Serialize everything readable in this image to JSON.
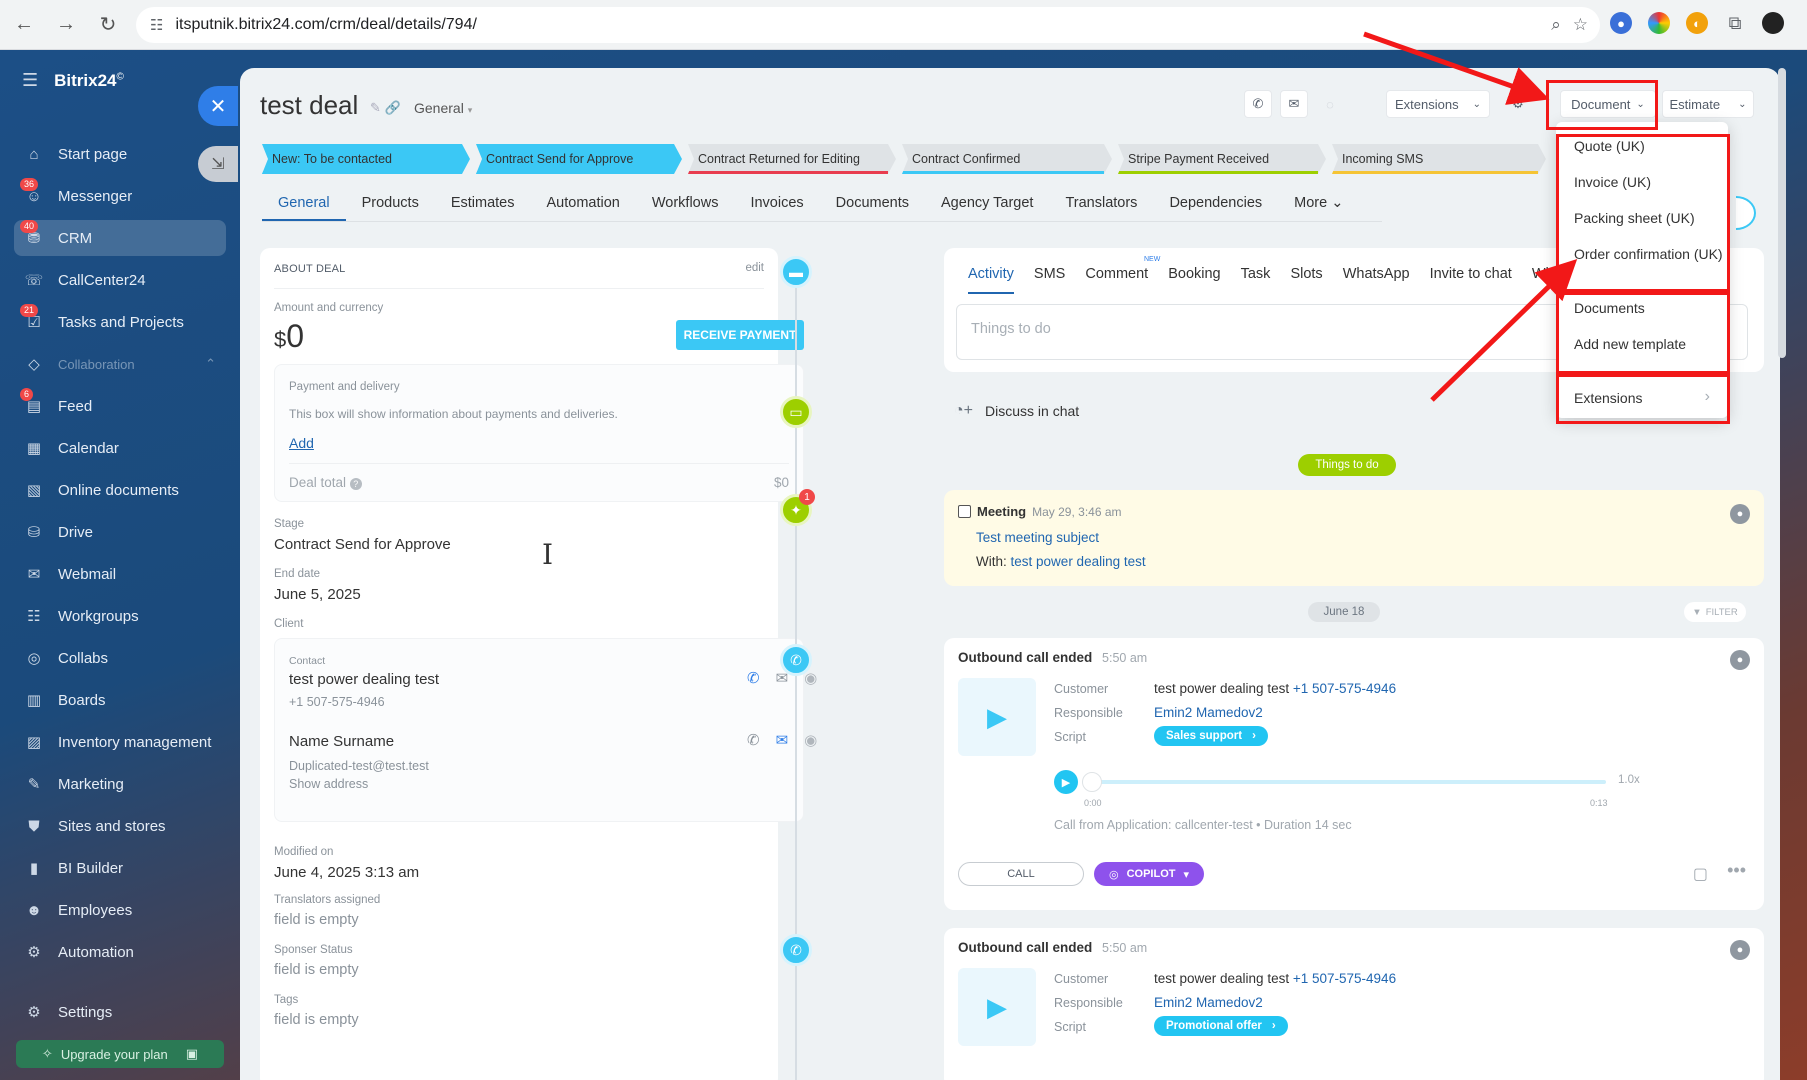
{
  "browser": {
    "url": "itsputnik.bitrix24.com/crm/deal/details/794/"
  },
  "sidebar": {
    "logo": "Bitrix24",
    "logo_sup": "©",
    "items": [
      {
        "label": "Start page",
        "badge": ""
      },
      {
        "label": "Messenger",
        "badge": "36"
      },
      {
        "label": "CRM",
        "badge": "40"
      },
      {
        "label": "CallCenter24",
        "badge": ""
      },
      {
        "label": "Tasks and Projects",
        "badge": "21"
      },
      {
        "label": "Collaboration",
        "badge": ""
      },
      {
        "label": "Feed",
        "badge": "6"
      },
      {
        "label": "Calendar",
        "badge": ""
      },
      {
        "label": "Online documents",
        "badge": ""
      },
      {
        "label": "Drive",
        "badge": ""
      },
      {
        "label": "Webmail",
        "badge": ""
      },
      {
        "label": "Workgroups",
        "badge": ""
      },
      {
        "label": "Collabs",
        "badge": ""
      },
      {
        "label": "Boards",
        "badge": ""
      },
      {
        "label": "Inventory management",
        "badge": ""
      },
      {
        "label": "Marketing",
        "badge": ""
      },
      {
        "label": "Sites and stores",
        "badge": ""
      },
      {
        "label": "BI Builder",
        "badge": ""
      },
      {
        "label": "Employees",
        "badge": ""
      },
      {
        "label": "Automation",
        "badge": ""
      },
      {
        "label": "Settings",
        "badge": ""
      }
    ],
    "upgrade": "Upgrade your plan"
  },
  "header": {
    "title": "test deal",
    "category": "General",
    "extensions": "Extensions",
    "document": "Document",
    "estimate": "Estimate"
  },
  "stages": [
    {
      "label": "New: To be contacted",
      "color": "#3bc8f5",
      "done": true
    },
    {
      "label": "Contract Send for Approve",
      "color": "#3bc8f5",
      "done": true
    },
    {
      "label": "Contract Returned for Editing",
      "color": "#e83d4f",
      "done": false
    },
    {
      "label": "Contract Confirmed",
      "color": "#3bc8f5",
      "done": false
    },
    {
      "label": "Stripe Payment Received",
      "color": "#9dcf00",
      "done": false
    },
    {
      "label": "Incoming SMS",
      "color": "#f5c434",
      "done": false
    }
  ],
  "tabs": [
    "General",
    "Products",
    "Estimates",
    "Automation",
    "Workflows",
    "Invoices",
    "Documents",
    "Agency Target",
    "Translators",
    "Dependencies",
    "More"
  ],
  "about": {
    "heading": "ABOUT DEAL",
    "edit": "edit",
    "amount_label": "Amount and currency",
    "currency": "$",
    "amount": "0",
    "receive_payment": "RECEIVE PAYMENT",
    "payment_label": "Payment and delivery",
    "payment_info": "This box will show information about payments and deliveries.",
    "add": "Add",
    "deal_total_label": "Deal total",
    "deal_total": "$0",
    "stage_label": "Stage",
    "stage": "Contract Send for Approve",
    "end_date_label": "End date",
    "end_date": "June 5, 2025",
    "client_label": "Client",
    "contact_label": "Contact",
    "contact_name": "test power dealing test",
    "contact_phone": "+1 507-575-4946",
    "contact2_name": "Name Surname",
    "contact2_email": "Duplicated-test@test.test",
    "show_address": "Show address",
    "modified_label": "Modified on",
    "modified": "June 4, 2025 3:13 am",
    "translators_label": "Translators assigned",
    "translators": "field is empty",
    "sponsor_label": "Sponser Status",
    "sponsor": "field is empty",
    "tags_label": "Tags",
    "tags": "field is empty"
  },
  "activity": {
    "tabs": [
      "Activity",
      "SMS",
      "Comment",
      "Booking",
      "Task",
      "Slots",
      "WhatsApp",
      "Invite to chat",
      "Wha"
    ],
    "new_badge": "NEW",
    "placeholder": "Things to do",
    "discuss": "Discuss in chat",
    "todo_badge": "Things to do",
    "meeting": {
      "title": "Meeting",
      "time": "May 29, 3:46 am",
      "subject": "Test meeting subject",
      "with_label": "With:",
      "with": "test power dealing test",
      "badge": "1"
    },
    "date_sep": "June 18",
    "filter": "FILTER",
    "call1": {
      "title": "Outbound call ended",
      "time": "5:50 am",
      "customer_label": "Customer",
      "customer": "test power dealing test",
      "phone": "+1 507-575-4946",
      "responsible_label": "Responsible",
      "responsible": "Emin2 Mamedov2",
      "script_label": "Script",
      "script": "Sales support",
      "start": "0:00",
      "end": "0:13",
      "speed": "1.0x",
      "progress": 0,
      "info": "Call from Application: callcenter-test • Duration 14 sec",
      "call_btn": "CALL",
      "copilot": "COPILOT"
    },
    "call2": {
      "title": "Outbound call ended",
      "time": "5:50 am",
      "customer_label": "Customer",
      "customer": "test power dealing test",
      "phone": "+1 507-575-4946",
      "responsible_label": "Responsible",
      "responsible": "Emin2 Mamedov2",
      "script_label": "Script",
      "script": "Promotional offer"
    }
  },
  "dropdown": {
    "items": [
      "Quote (UK)",
      "Invoice (UK)",
      "Packing sheet (UK)",
      "Order confirmation (UK)",
      "Documents",
      "Add new template",
      "Extensions"
    ]
  }
}
